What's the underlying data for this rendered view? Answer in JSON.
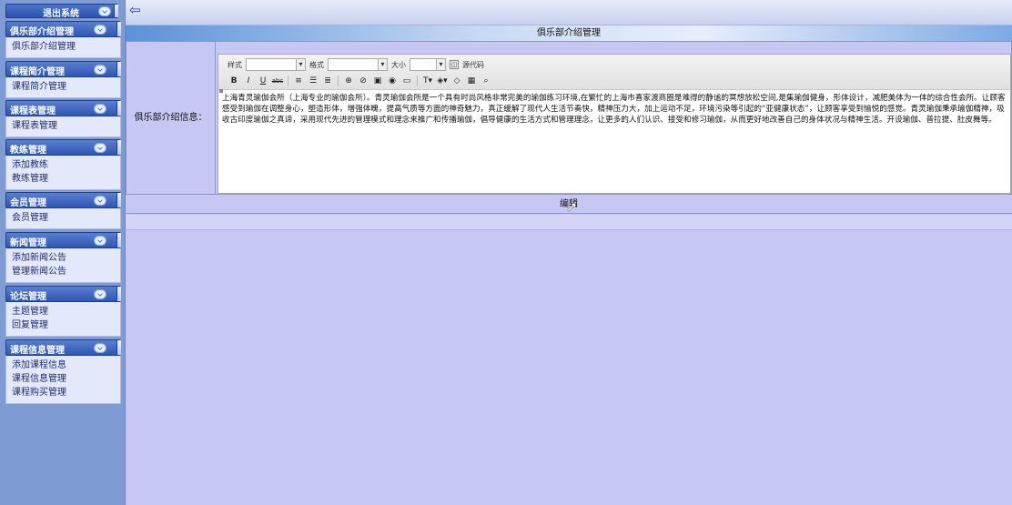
{
  "sidebar": {
    "logout_label": "退出系统",
    "groups": [
      {
        "title": "俱乐部介绍管理",
        "items": [
          "俱乐部介绍管理"
        ]
      },
      {
        "title": "课程简介管理",
        "items": [
          "课程简介管理"
        ]
      },
      {
        "title": "课程表管理",
        "items": [
          "课程表管理"
        ]
      },
      {
        "title": "教练管理",
        "items": [
          "添加教练",
          "教练管理"
        ]
      },
      {
        "title": "会员管理",
        "items": [
          "会员管理"
        ]
      },
      {
        "title": "新闻管理",
        "items": [
          "添加新闻公告",
          "管理新闻公告"
        ]
      },
      {
        "title": "论坛管理",
        "items": [
          "主题管理",
          "回复管理"
        ]
      },
      {
        "title": "课程信息管理",
        "items": [
          "添加课程信息",
          "课程信息管理",
          "课程购买管理"
        ]
      }
    ]
  },
  "main": {
    "page_title": "俱乐部介绍管理",
    "field_label": "俱乐部介绍信息：",
    "submit_label": "编辑"
  },
  "editor": {
    "style_label": "样式",
    "format_label": "格式",
    "size_label": "大小",
    "source_label": "源代码",
    "content": "上海青灵瑜伽会所（上海专业的瑜伽会所）。青灵瑜伽会所是一个具有时尚风格非常完美的瑜伽练习环境,在繁忙的上海市喜家渡商圈是难得的静谧的冥想放松空间,是集瑜伽健身，形体设计，减肥美体为一体的综合性会所。让顾客感受到瑜伽在调整身心，塑造形体，增强体魄，提高气质等方面的神奇魅力，真正缓解了现代人生活节奏快，精神压力大，加上运动不足，环境污染等引起的“亚健康状态”，让顾客享受到愉悦的感觉。青灵瑜伽秉承瑜伽精神，吸收古印度瑜伽之真谛，采用现代先进的管理模式和理念来推广和传播瑜伽，倡导健康的生活方式和管理理念，让更多的人们认识、接受和修习瑜伽，从而更好地改善自己的身体状况与精神生活。开设瑜伽、普拉提、肚皮舞等。"
  },
  "colors": {
    "sidebar_bg": "#7f9bd4",
    "content_bg": "#c7c7f3",
    "group_header": "#2e56b3"
  }
}
